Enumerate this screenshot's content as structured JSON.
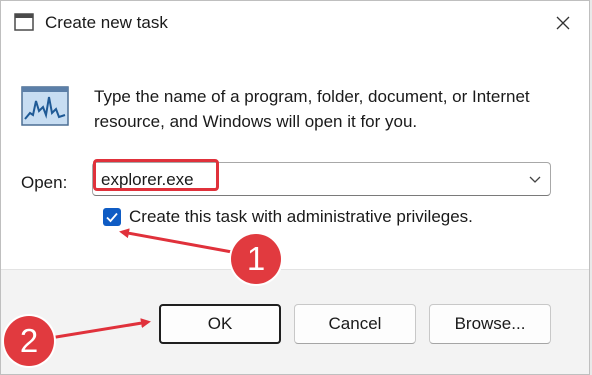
{
  "window": {
    "title": "Create new task",
    "close_icon": "close-icon",
    "app_icon": "run-dialog-icon"
  },
  "content": {
    "icon": "task-manager-icon",
    "description": "Type the name of a program, folder, document, or Internet resource, and Windows will open it for you.",
    "open_label": "Open:",
    "open_value": "explorer.exe",
    "dropdown_icon": "chevron-down-icon",
    "admin_checkbox": {
      "label": "Create this task with administrative privileges.",
      "checked": true
    }
  },
  "buttons": {
    "ok": "OK",
    "cancel": "Cancel",
    "browse": "Browse..."
  },
  "annotations": {
    "step1": "1",
    "step2": "2",
    "accent_color": "#e0313b"
  },
  "colors": {
    "checkbox_blue": "#0f5cc4",
    "footer_bg": "#f3f3f3"
  }
}
